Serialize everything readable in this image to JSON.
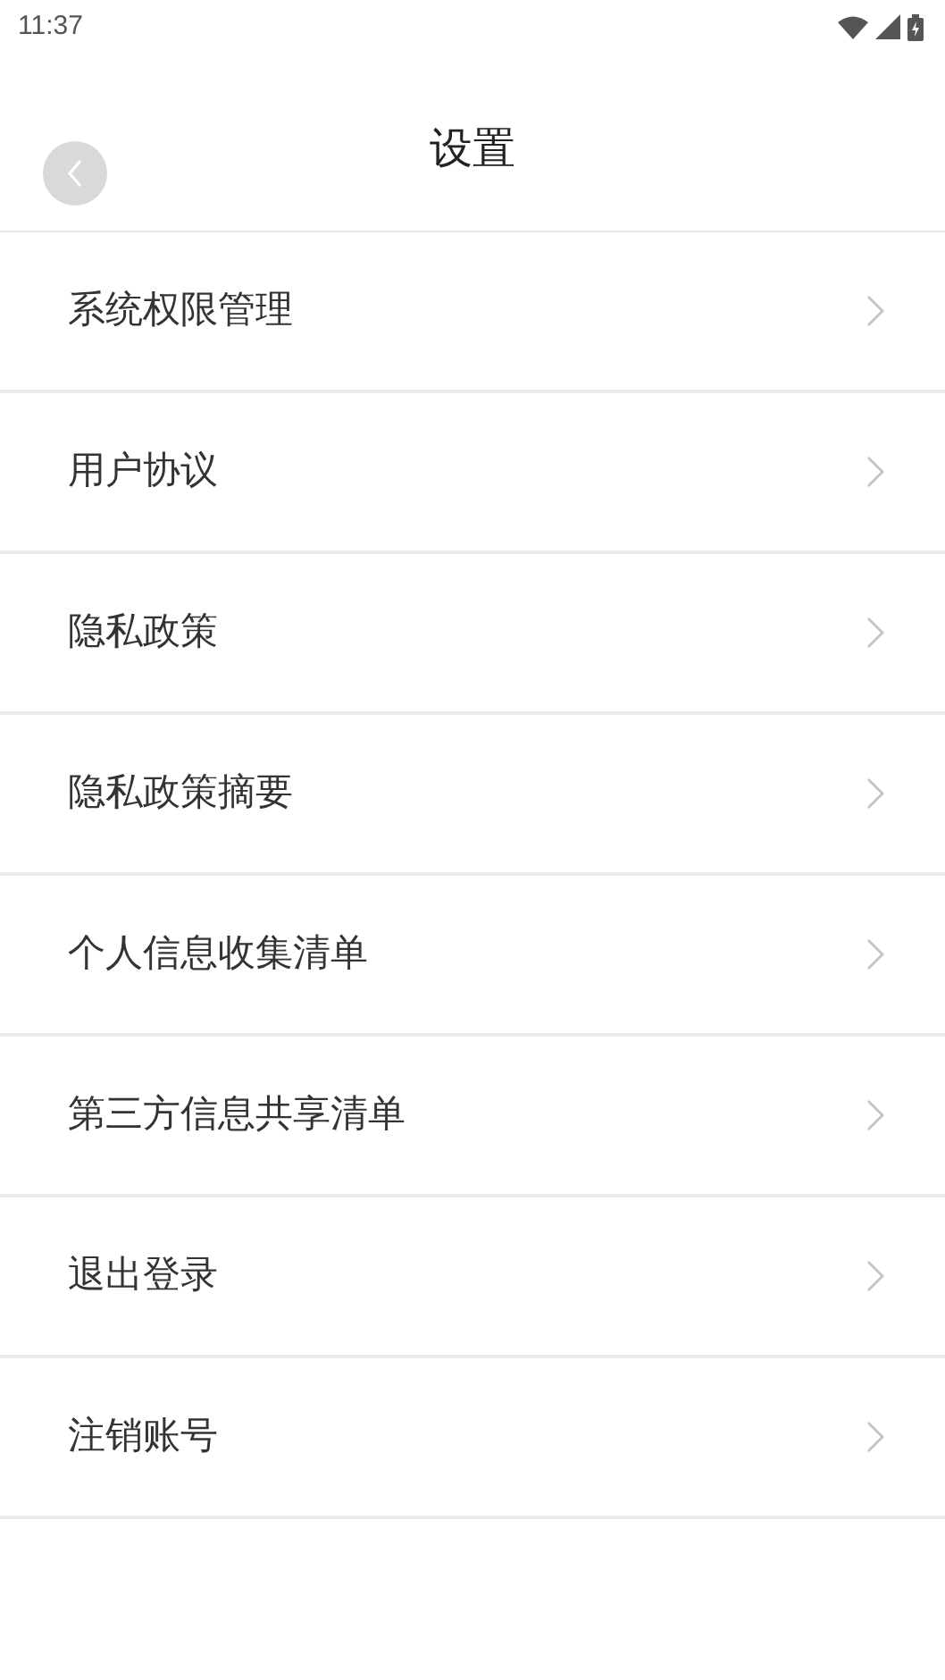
{
  "status_bar": {
    "time": "11:37"
  },
  "header": {
    "title": "设置"
  },
  "items": [
    {
      "label": "系统权限管理"
    },
    {
      "label": "用户协议"
    },
    {
      "label": "隐私政策"
    },
    {
      "label": "隐私政策摘要"
    },
    {
      "label": "个人信息收集清单"
    },
    {
      "label": "第三方信息共享清单"
    },
    {
      "label": "退出登录"
    },
    {
      "label": "注销账号"
    }
  ]
}
